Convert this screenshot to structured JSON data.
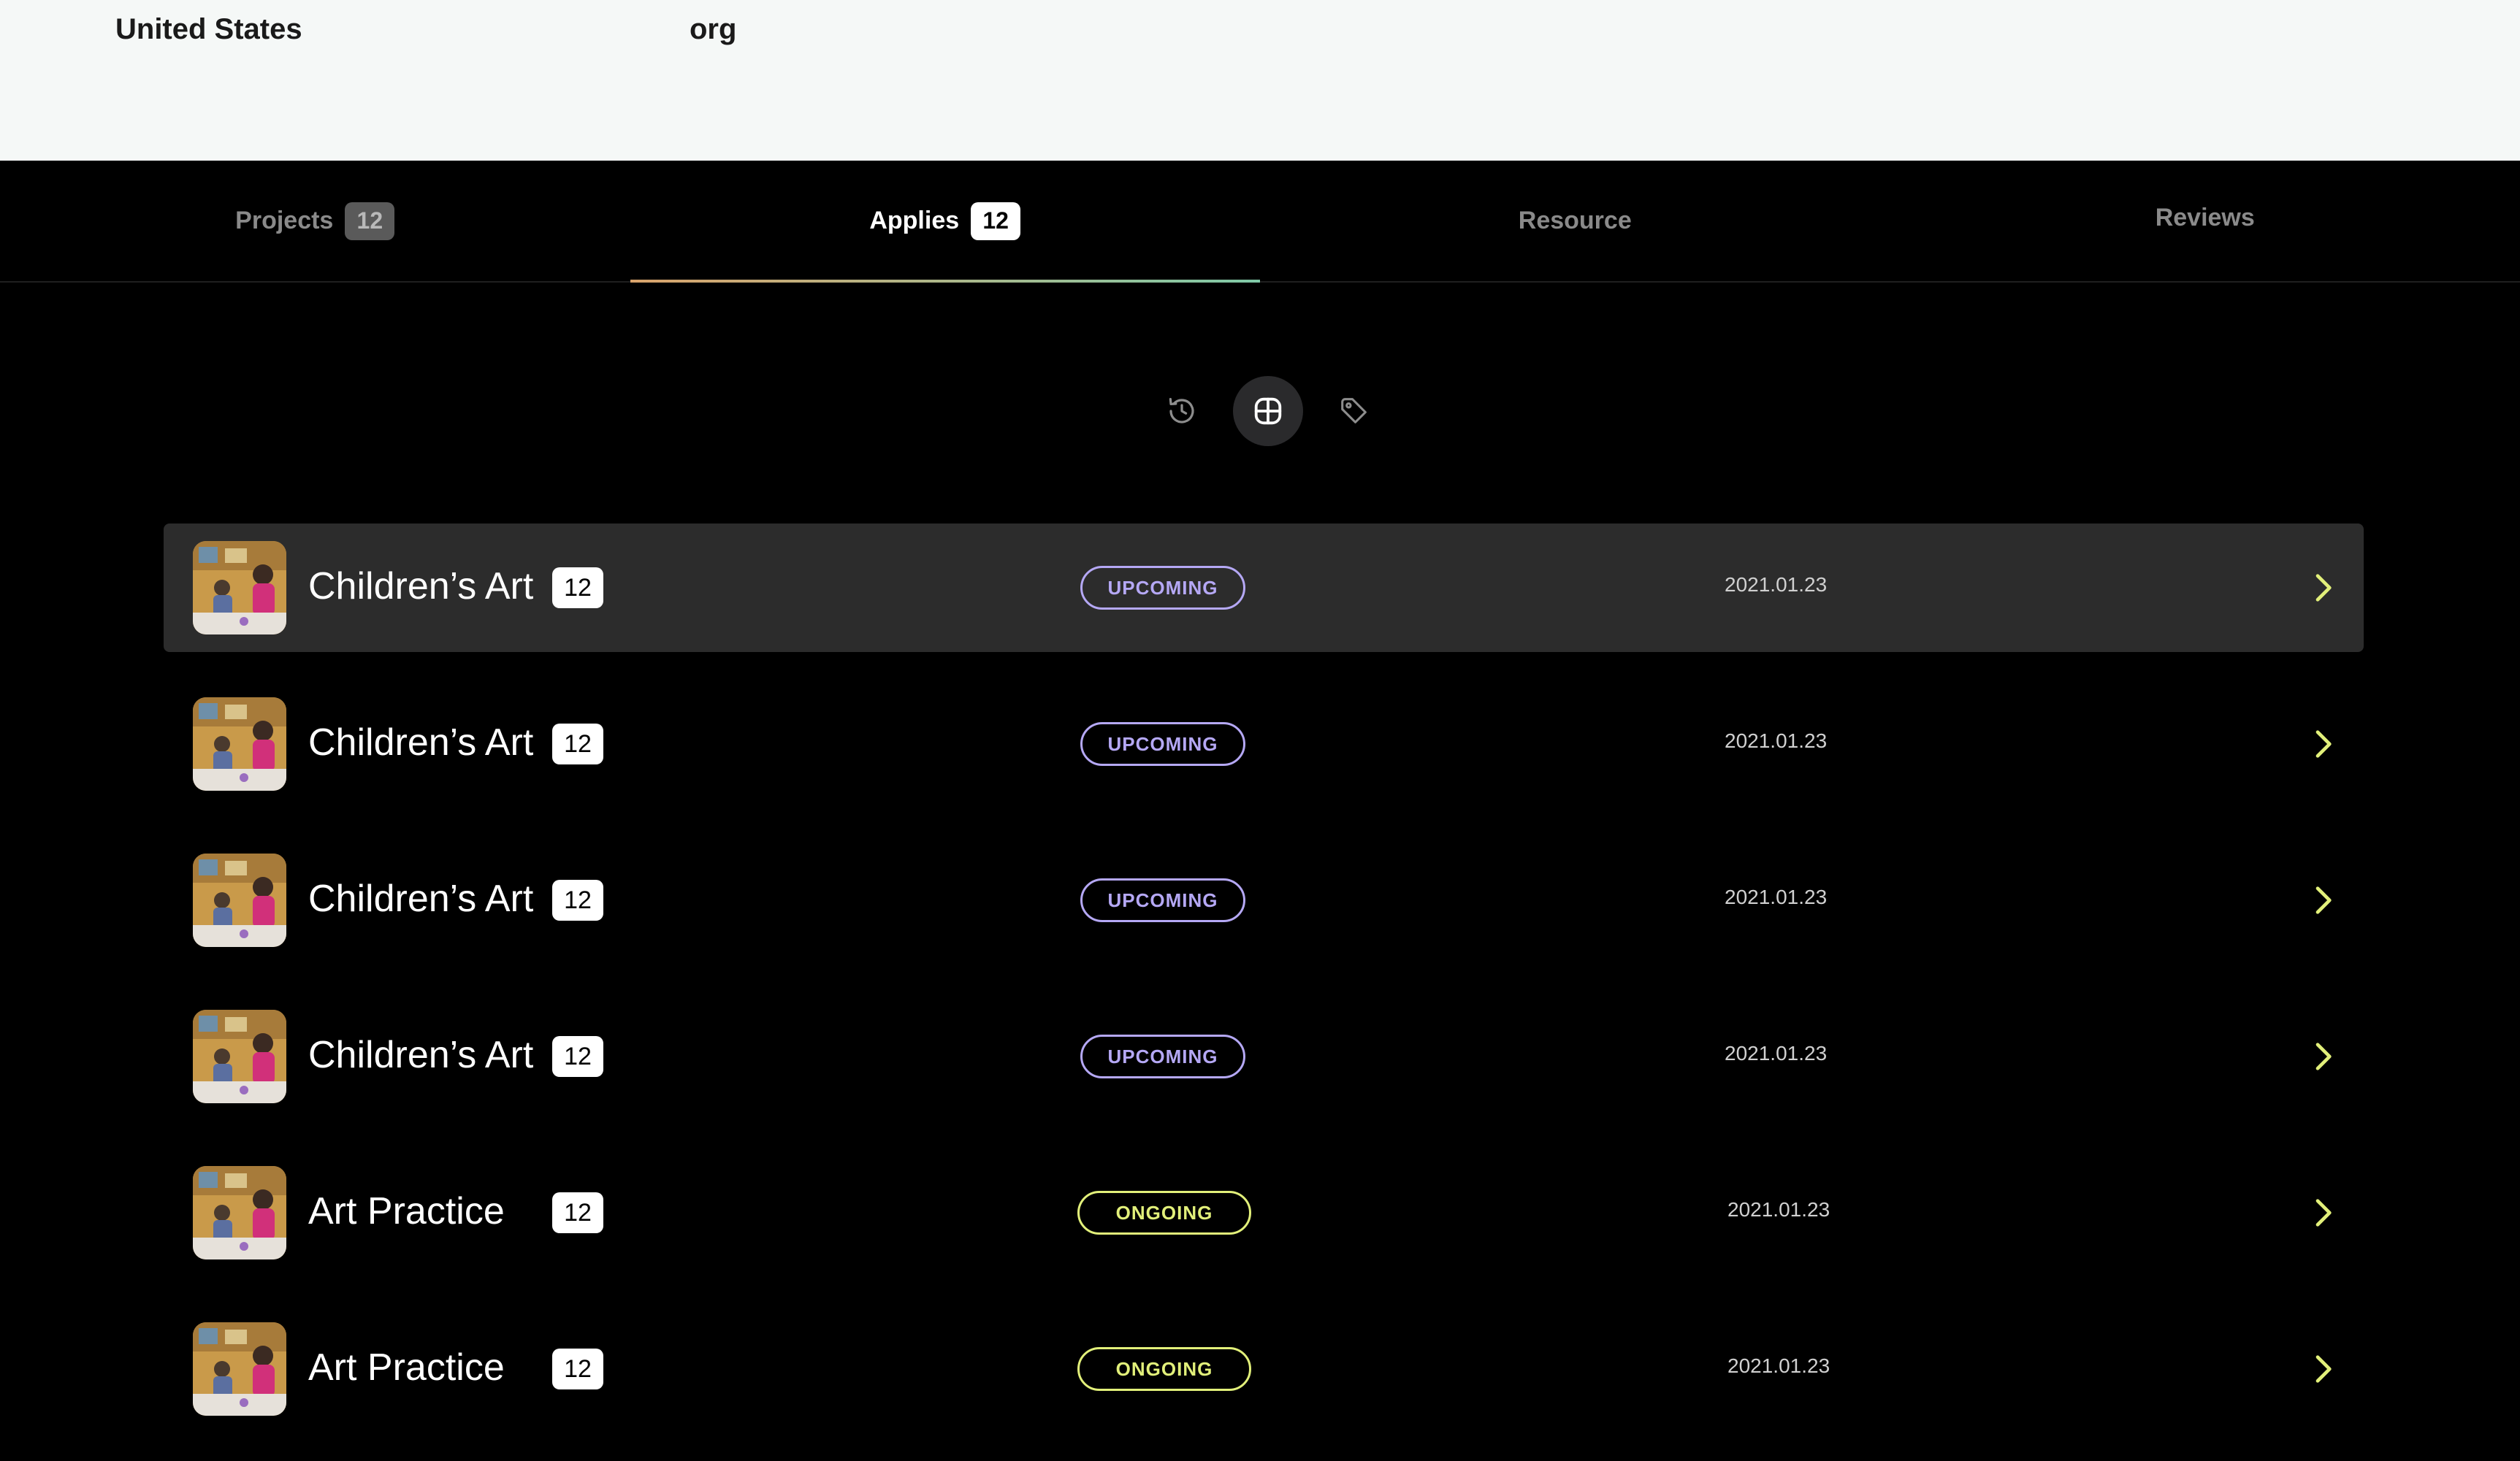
{
  "header": {
    "country": "United States",
    "org_type": "org"
  },
  "tabs": [
    {
      "label": "Projects",
      "count": "12"
    },
    {
      "label": "Applies",
      "count": "12",
      "active": true
    },
    {
      "label": "Resource"
    },
    {
      "label": "Reviews"
    }
  ],
  "view_switcher": {
    "icons": [
      "history-icon",
      "grid-icon",
      "tag-icon"
    ],
    "active": "grid-icon"
  },
  "rows": [
    {
      "title": "Children’s Art",
      "count": "12",
      "status": "UPCOMING",
      "date": "2021.01.23"
    },
    {
      "title": "Children’s Art",
      "count": "12",
      "status": "UPCOMING",
      "date": "2021.01.23"
    },
    {
      "title": "Children’s Art",
      "count": "12",
      "status": "UPCOMING",
      "date": "2021.01.23"
    },
    {
      "title": "Children’s Art",
      "count": "12",
      "status": "UPCOMING",
      "date": "2021.01.23"
    },
    {
      "title": "Art Practice",
      "count": "12",
      "status": "ONGOING",
      "date": "2021.01.23"
    },
    {
      "title": "Art Practice",
      "count": "12",
      "status": "ONGOING",
      "date": "2021.01.23"
    }
  ],
  "colors": {
    "upcoming": "#b5a8f5",
    "ongoing": "#e2f07a",
    "chevron": "#e2f07a",
    "tab_underline_start": "#d9a36b",
    "tab_underline_end": "#7fc9a7"
  }
}
